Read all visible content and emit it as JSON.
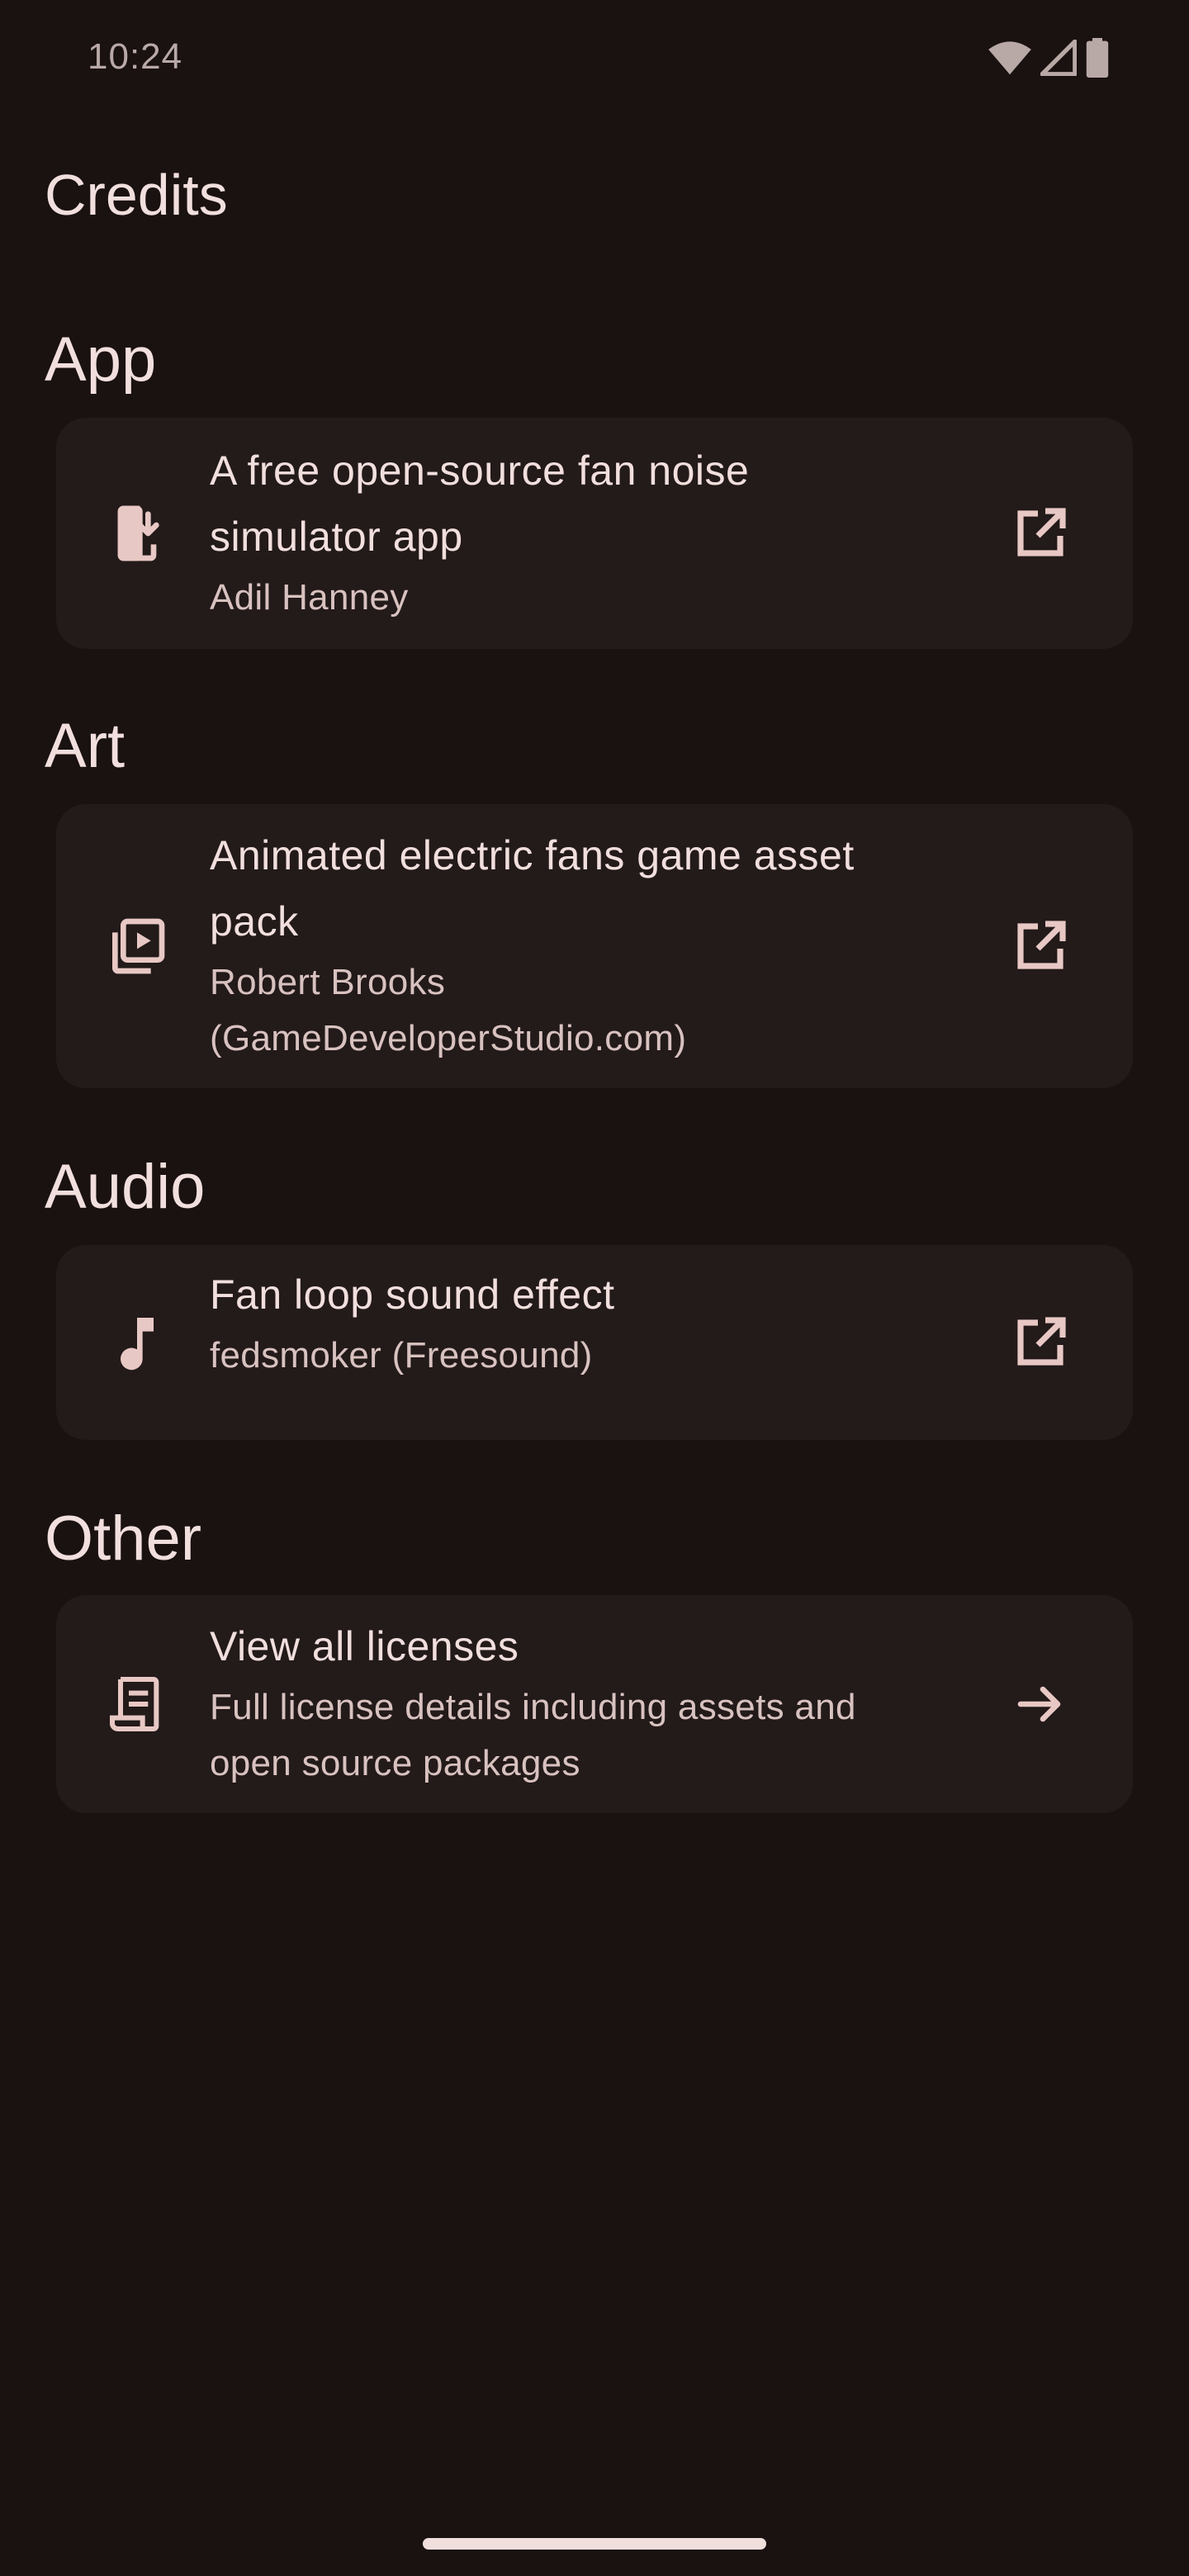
{
  "status_bar": {
    "time": "10:24",
    "icons": [
      "wifi-icon",
      "cellular-signal-icon",
      "battery-icon"
    ]
  },
  "page": {
    "title": "Credits"
  },
  "sections": [
    {
      "heading": "App",
      "card": {
        "icon": "install-mobile-icon",
        "title_lines": [
          "A free open-source fan noise",
          "simulator app"
        ],
        "subtitle_lines": [
          "Adil Hanney"
        ],
        "action_icon": "open-in-new-icon"
      }
    },
    {
      "heading": "Art",
      "card": {
        "icon": "video-library-icon",
        "title_lines": [
          "Animated electric fans game asset",
          "pack"
        ],
        "subtitle_lines": [
          "Robert Brooks",
          "(GameDeveloperStudio.com)"
        ],
        "action_icon": "open-in-new-icon"
      }
    },
    {
      "heading": "Audio",
      "card": {
        "icon": "music-note-icon",
        "title_lines": [
          "Fan loop sound effect"
        ],
        "subtitle_lines": [
          "fedsmoker (Freesound)"
        ],
        "action_icon": "open-in-new-icon"
      }
    },
    {
      "heading": "Other",
      "card": {
        "icon": "license-document-icon",
        "title_lines": [
          "View all licenses"
        ],
        "subtitle_lines": [
          "Full license details including assets and",
          "open source packages"
        ],
        "action_icon": "arrow-forward-icon"
      }
    }
  ],
  "colors": {
    "background": "#1a1111",
    "card": "#231a1a",
    "text_primary": "#f1dfdd",
    "text_secondary": "#d8c2bf",
    "icon": "#e8c8c4"
  }
}
